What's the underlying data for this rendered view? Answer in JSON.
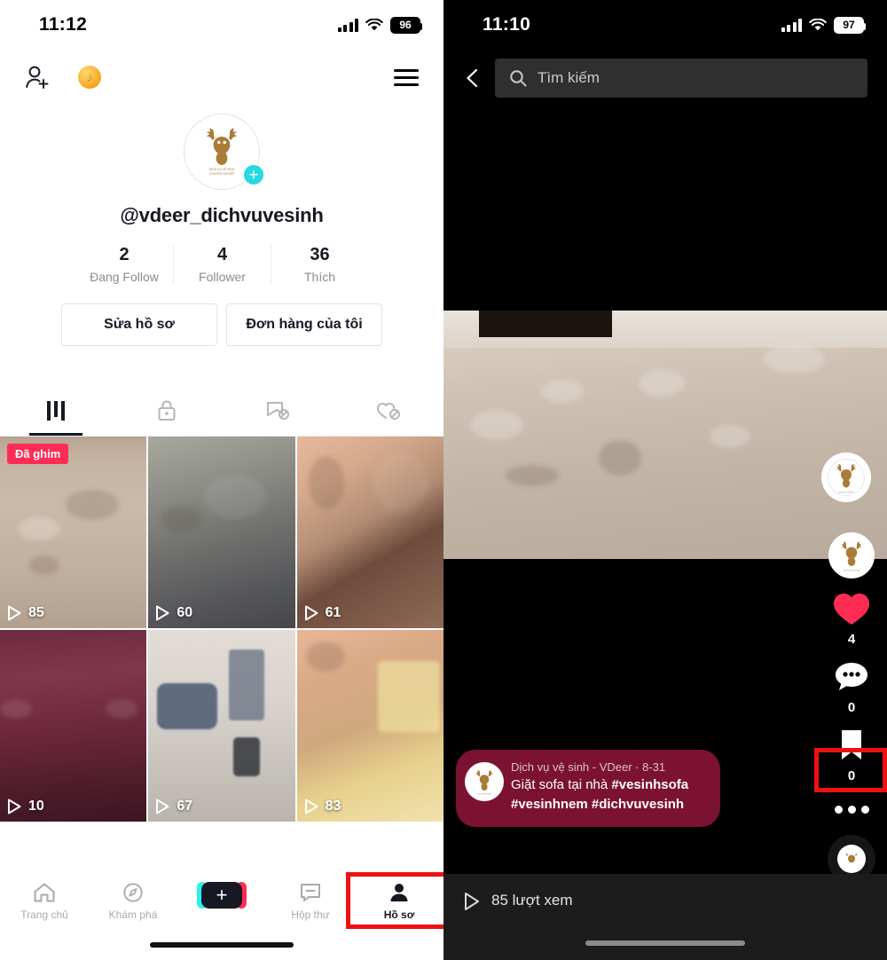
{
  "left_phone": {
    "status": {
      "time": "11:12",
      "battery": "96",
      "signal_icon": "cellular-signal-icon",
      "wifi_icon": "wifi-icon"
    },
    "topbar": {
      "add_friend_icon": "add-person-icon",
      "coin_icon": "tiktok-coin-icon",
      "menu_icon": "hamburger-menu-icon"
    },
    "profile": {
      "avatar_icon": "deer-logo-avatar",
      "avatar_alt": "DỊCH VỤ VỆ SINH CHUYÊN NGHIỆP",
      "add_badge": "+",
      "username": "@vdeer_dichvuvesinh",
      "stats": [
        {
          "num": "2",
          "label": "Đang Follow"
        },
        {
          "num": "4",
          "label": "Follower"
        },
        {
          "num": "36",
          "label": "Thích"
        }
      ],
      "buttons": [
        {
          "label": "Sửa hồ sơ",
          "name": "edit-profile-button"
        },
        {
          "label": "Đơn hàng của tôi",
          "name": "my-orders-button"
        }
      ]
    },
    "tabs": [
      {
        "name": "tab-videos",
        "icon": "grid-icon",
        "active": true
      },
      {
        "name": "tab-private",
        "icon": "lock-icon",
        "active": false
      },
      {
        "name": "tab-reposts",
        "icon": "repost-off-icon",
        "active": false
      },
      {
        "name": "tab-liked",
        "icon": "heart-off-icon",
        "active": false
      }
    ],
    "videos": [
      {
        "views": "85",
        "pinned_label": "Đã ghim",
        "thumb": "beige-dirty-sofa"
      },
      {
        "views": "60",
        "pinned_label": "",
        "thumb": "grey-sofa-cleaning"
      },
      {
        "views": "61",
        "pinned_label": "",
        "thumb": "hands-cloth"
      },
      {
        "views": "10",
        "pinned_label": "",
        "thumb": "maroon-sofa"
      },
      {
        "views": "67",
        "pinned_label": "",
        "thumb": "blue-sofa-vacuum"
      },
      {
        "views": "83",
        "pinned_label": "",
        "thumb": "fabric-yellow-closeup"
      }
    ],
    "bottom_nav": [
      {
        "label": "Trang chủ",
        "icon": "home-icon",
        "name": "nav-home",
        "active": false
      },
      {
        "label": "Khám phá",
        "icon": "compass-icon",
        "name": "nav-discover",
        "active": false
      },
      {
        "label": "",
        "icon": "create-plus-icon",
        "name": "nav-create",
        "active": false
      },
      {
        "label": "Hộp thư",
        "icon": "inbox-icon",
        "name": "nav-inbox",
        "active": false
      },
      {
        "label": "Hồ sơ",
        "icon": "person-icon",
        "name": "nav-profile",
        "active": true
      }
    ],
    "highlight_color": "#ee1111"
  },
  "right_phone": {
    "status": {
      "time": "11:10",
      "battery": "97",
      "signal_icon": "cellular-signal-icon",
      "wifi_icon": "wifi-icon"
    },
    "header": {
      "back_icon": "back-chevron-icon",
      "search_icon": "search-icon",
      "search_placeholder": "Tìm kiếm",
      "search_value": ""
    },
    "video": {
      "watermark_icon": "deer-logo-watermark",
      "rail": {
        "avatar_icon": "deer-logo-avatar",
        "like_icon": "heart-icon",
        "like_count": "4",
        "comment_icon": "comment-icon",
        "comment_count": "0",
        "bookmark_icon": "bookmark-icon",
        "bookmark_count": "0",
        "more_icon": "three-dots-icon",
        "music_icon": "music-disc-icon"
      },
      "caption": {
        "avatar_icon": "deer-logo-avatar",
        "meta": "Dịch vụ vệ sinh - VDeer · 8-31",
        "line1_text": "Giặt sofa tại nhà ",
        "line1_tag": "#vesinhsofa",
        "line2_tags": "#vesinhnem #dichvuvesinh"
      },
      "view_icon": "play-icon",
      "view_text": "85 lượt xem"
    },
    "highlight_color": "#ee1111"
  }
}
